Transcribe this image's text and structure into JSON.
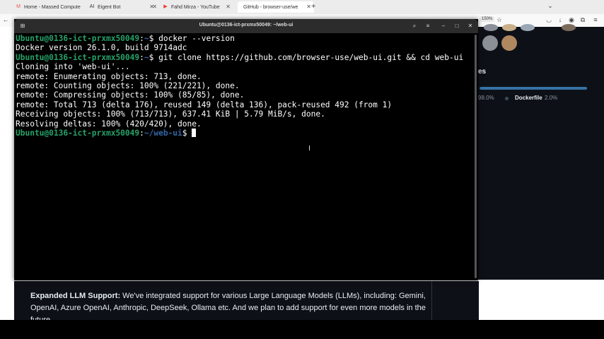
{
  "browser": {
    "tabs": [
      {
        "icon": "M",
        "label": "Home - Massed Compute"
      },
      {
        "icon": "AI",
        "label": "Eigent Bot"
      },
      {
        "icon": "▶",
        "label": "Fahd Mirza - YouTube"
      },
      {
        "icon": "",
        "label": "GitHub - browser-use/we"
      }
    ],
    "zoom": "150%"
  },
  "page_behind": {
    "languages_heading": "es",
    "lang_pct1": "98.0%",
    "lang_name": "Dockerfile",
    "lang_pct2": "2.0%",
    "readme_bold": "Expanded LLM Support:",
    "readme_text": " We've integrated support for various Large Language Models (LLMs), including: Gemini, OpenAI, Azure OpenAI, Anthropic, DeepSeek, Ollama etc. And we plan to add support for even more models in the future."
  },
  "terminal": {
    "title": "Ubuntu@0136-ict-prxmx50049: ~/web-ui",
    "prompt_user": "Ubuntu@0136-ict-prxmx50049",
    "lines": [
      {
        "type": "prompt",
        "path": "~",
        "cmd": " docker --version"
      },
      {
        "type": "out",
        "text": "Docker version 26.1.0, build 9714adc"
      },
      {
        "type": "prompt",
        "path": "~",
        "cmd": " git clone https://github.com/browser-use/web-ui.git && cd web-ui"
      },
      {
        "type": "out",
        "text": "Cloning into 'web-ui'..."
      },
      {
        "type": "out",
        "text": "remote: Enumerating objects: 713, done."
      },
      {
        "type": "out",
        "text": "remote: Counting objects: 100% (221/221), done."
      },
      {
        "type": "out",
        "text": "remote: Compressing objects: 100% (85/85), done."
      },
      {
        "type": "out",
        "text": "remote: Total 713 (delta 176), reused 149 (delta 136), pack-reused 492 (from 1)"
      },
      {
        "type": "out",
        "text": "Receiving objects: 100% (713/713), 637.41 KiB | 5.79 MiB/s, done."
      },
      {
        "type": "out",
        "text": "Resolving deltas: 100% (420/420), done."
      },
      {
        "type": "prompt",
        "path": "~/web-ui",
        "cmd": " "
      }
    ]
  }
}
